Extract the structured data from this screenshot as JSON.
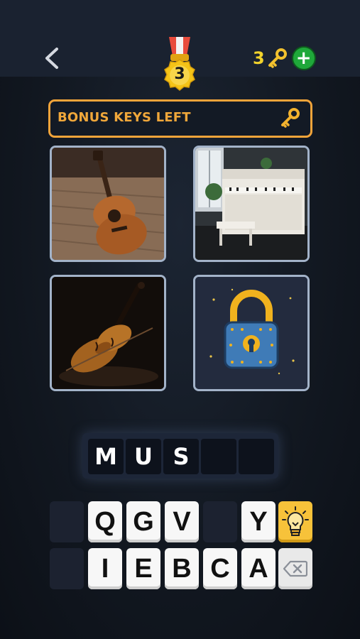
{
  "header": {
    "level": "3",
    "keys_count": "3",
    "add_label": "+"
  },
  "bonus": {
    "label": "BONUS KEYS LEFT"
  },
  "answer": {
    "slots": [
      "M",
      "U",
      "S",
      "",
      ""
    ]
  },
  "keyboard": {
    "row1": [
      "",
      "Q",
      "G",
      "V",
      "",
      "Y"
    ],
    "row2": [
      "",
      "I",
      "E",
      "B",
      "C",
      "A"
    ]
  },
  "colors": {
    "accent_orange": "#f0a73a",
    "key_gold": "#f2d32c",
    "add_green": "#1fa83a",
    "hint_yellow": "#f7c23a"
  }
}
